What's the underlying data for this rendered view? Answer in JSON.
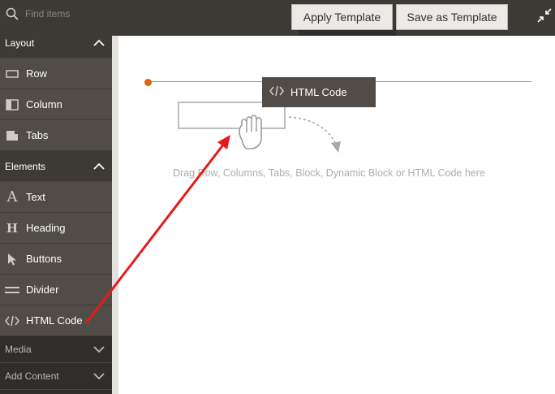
{
  "search": {
    "placeholder": "Find items"
  },
  "toolbar": {
    "apply_label": "Apply Template",
    "save_label": "Save as Template"
  },
  "sidebar": {
    "layout": {
      "title": "Layout",
      "items": [
        {
          "label": "Row",
          "icon": "row-icon"
        },
        {
          "label": "Column",
          "icon": "column-icon"
        },
        {
          "label": "Tabs",
          "icon": "tabs-icon"
        }
      ]
    },
    "elements": {
      "title": "Elements",
      "items": [
        {
          "label": "Text",
          "icon": "text-icon"
        },
        {
          "label": "Heading",
          "icon": "heading-icon"
        },
        {
          "label": "Buttons",
          "icon": "cursor-icon"
        },
        {
          "label": "Divider",
          "icon": "divider-icon"
        },
        {
          "label": "HTML Code",
          "icon": "code-icon"
        }
      ]
    },
    "media": {
      "title": "Media"
    },
    "add_content": {
      "title": "Add Content"
    }
  },
  "stage": {
    "drag_helper_label": "HTML Code",
    "hint": "Drag Row, Columns, Tabs, Block, Dynamic Block or HTML Code here"
  },
  "colors": {
    "sidebar_bg": "#302d2a",
    "item_bg": "#514c47",
    "accent_orange": "#e0630d",
    "annotation_red": "#e8191b"
  }
}
